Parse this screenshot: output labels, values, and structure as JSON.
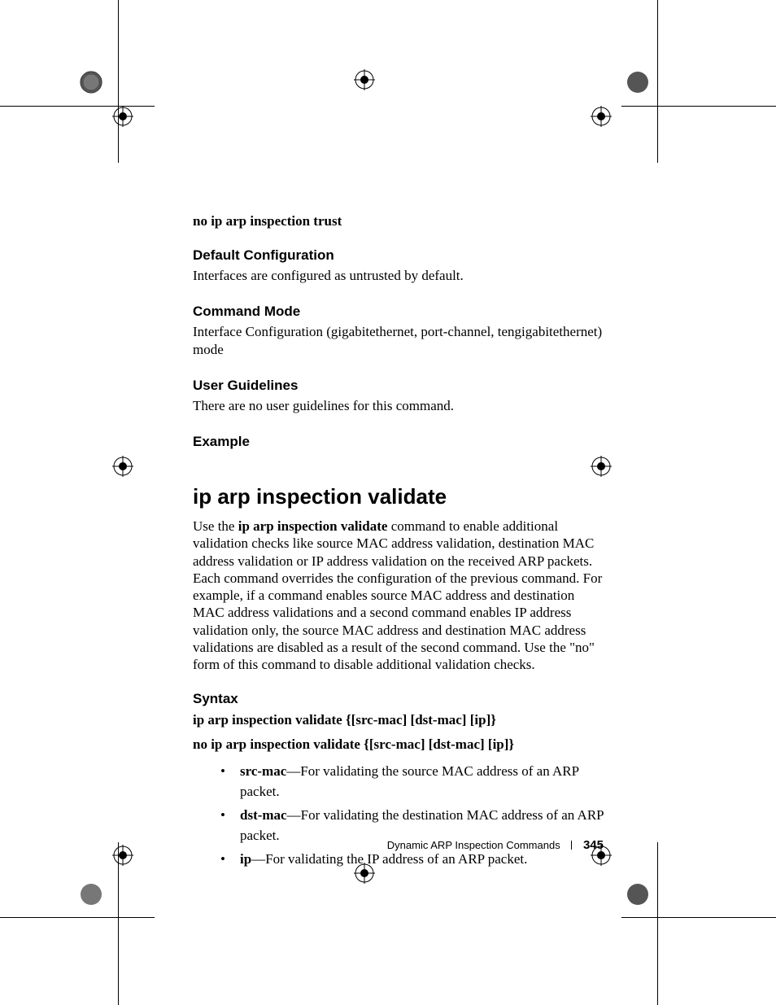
{
  "top": {
    "no_line": "no ip arp inspection trust",
    "defcfg_h": "Default Configuration",
    "defcfg_b": "Interfaces are configured as untrusted by default.",
    "cmdmode_h": "Command Mode",
    "cmdmode_b": "Interface Configuration (gigabitethernet, port-channel, tengigabitethernet) mode",
    "ugl_h": "User Guidelines",
    "ugl_b": "There are no user guidelines for this command.",
    "ex_h": "Example"
  },
  "main": {
    "heading": "ip arp inspection validate",
    "para_pre": "Use the ",
    "para_bold": "ip arp inspection validate",
    "para_post": " command to enable additional validation checks like source MAC address validation, destination MAC address validation or IP address validation on the received ARP packets. Each command overrides the configuration of the previous command. For example, if a command enables source MAC address and destination MAC address validations and a second command enables IP address validation only, the source MAC address and destination MAC address validations are disabled as a result of the second command. Use the \"no\" form of this command to disable additional validation checks."
  },
  "syntax": {
    "heading": "Syntax",
    "line1_pre": "ip arp inspection validate {[",
    "line1_b1": "src-mac",
    "line1_mid1": "] [",
    "line1_b2": "dst-mac",
    "line1_mid2": "] [",
    "line1_b3": "ip",
    "line1_post": "]}",
    "line2_pre": "no ip arp inspection validate {[",
    "line2_b1": "src-mac",
    "line2_mid1": "] [",
    "line2_b2": "dst-mac",
    "line2_mid2": "] [",
    "line2_b3": "ip",
    "line2_post": "]}",
    "bullets": [
      {
        "term": "src-mac",
        "desc": "—For validating the source MAC address of an ARP packet."
      },
      {
        "term": "dst-mac",
        "desc": "—For validating the destination MAC address of an ARP packet."
      },
      {
        "term": "ip",
        "desc": "—For validating the IP address of an ARP packet."
      }
    ]
  },
  "footer": {
    "section": "Dynamic ARP Inspection Commands",
    "page": "345"
  }
}
